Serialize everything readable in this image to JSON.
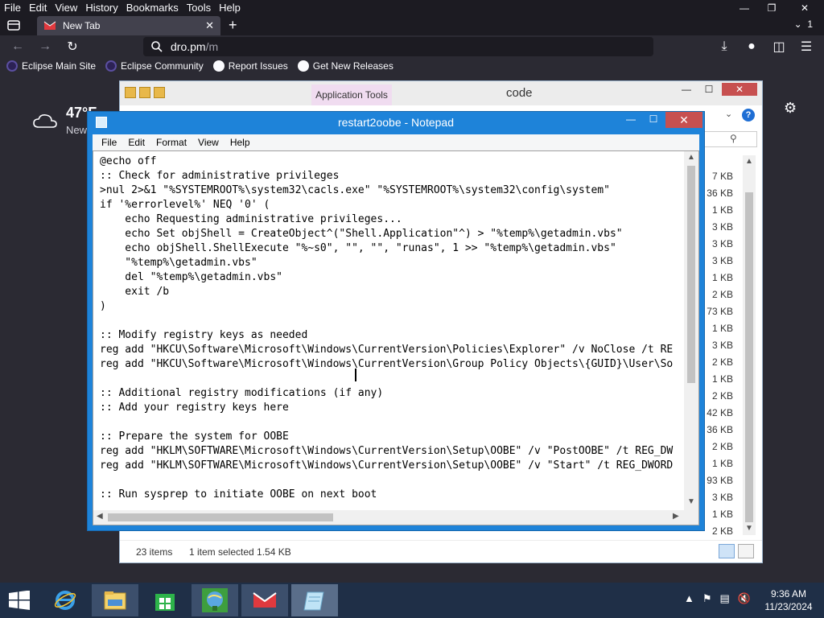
{
  "browser": {
    "menu": [
      "File",
      "Edit",
      "View",
      "History",
      "Bookmarks",
      "Tools",
      "Help"
    ],
    "tab_title": "New Tab",
    "url_host": "dro.pm",
    "url_path": "/m",
    "bookmarks": [
      "Eclipse Main Site",
      "Eclipse Community",
      "Report Issues",
      "Get New Releases"
    ],
    "accent_color": "#2b2a33"
  },
  "newtab": {
    "weather_temp": "47°F",
    "weather_location": "New"
  },
  "explorer": {
    "title": "code",
    "app_tools": "Application Tools",
    "sizes": [
      "7 KB",
      "36 KB",
      "1 KB",
      "3 KB",
      "3 KB",
      "3 KB",
      "1 KB",
      "2 KB",
      "73 KB",
      "1 KB",
      "3 KB",
      "2 KB",
      "1 KB",
      "2 KB",
      "42 KB",
      "36 KB",
      "2 KB",
      "1 KB",
      "93 KB",
      "3 KB",
      "1 KB",
      "2 KB"
    ],
    "item_count": "23 items",
    "selection": "1 item selected  1.54 KB"
  },
  "notepad": {
    "title": "restart2oobe - Notepad",
    "menu": [
      "File",
      "Edit",
      "Format",
      "View",
      "Help"
    ],
    "lines": [
      "@echo off",
      ":: Check for administrative privileges",
      ">nul 2>&1 \"%SYSTEMROOT%\\system32\\cacls.exe\" \"%SYSTEMROOT%\\system32\\config\\system\"",
      "if '%errorlevel%' NEQ '0' (",
      "    echo Requesting administrative privileges...",
      "    echo Set objShell = CreateObject^(\"Shell.Application\"^) > \"%temp%\\getadmin.vbs\"",
      "    echo objShell.ShellExecute \"%~s0\", \"\", \"\", \"runas\", 1 >> \"%temp%\\getadmin.vbs\"",
      "    \"%temp%\\getadmin.vbs\"",
      "    del \"%temp%\\getadmin.vbs\"",
      "    exit /b",
      ")",
      "",
      ":: Modify registry keys as needed",
      "reg add \"HKCU\\Software\\Microsoft\\Windows\\CurrentVersion\\Policies\\Explorer\" /v NoClose /t RE",
      "reg add \"HKCU\\Software\\Microsoft\\Windows\\CurrentVersion\\Group Policy Objects\\{GUID}\\User\\So",
      "",
      ":: Additional registry modifications (if any)",
      ":: Add your registry keys here",
      "",
      ":: Prepare the system for OOBE",
      "reg add \"HKLM\\SOFTWARE\\Microsoft\\Windows\\CurrentVersion\\Setup\\OOBE\" /v \"PostOOBE\" /t REG_DW",
      "reg add \"HKLM\\SOFTWARE\\Microsoft\\Windows\\CurrentVersion\\Setup\\OOBE\" /v \"Start\" /t REG_DWORD",
      "",
      ":: Run sysprep to initiate OOBE on next boot"
    ]
  },
  "taskbar": {
    "time": "9:36 AM",
    "date": "11/23/2024"
  }
}
